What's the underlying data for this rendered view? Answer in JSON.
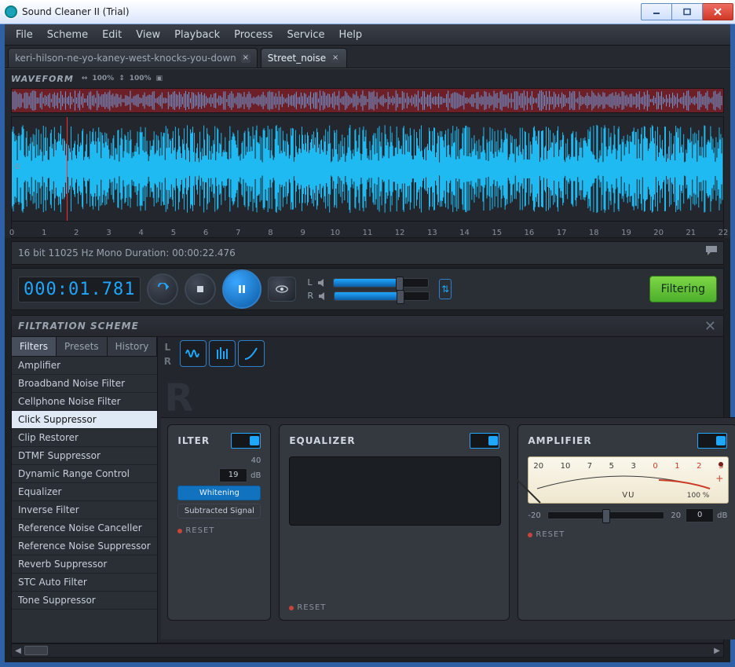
{
  "window": {
    "title": "Sound Cleaner II (Trial)"
  },
  "menu": {
    "items": [
      "File",
      "Scheme",
      "Edit",
      "View",
      "Playback",
      "Process",
      "Service",
      "Help"
    ]
  },
  "tabs": [
    {
      "label": "keri-hilson-ne-yo-kaney-west-knocks-you-down",
      "active": false
    },
    {
      "label": "Street_noise",
      "active": true
    }
  ],
  "waveform": {
    "header": "WAVEFORM",
    "zoom1": "100%",
    "zoom2": "100%",
    "ruler_ticks": [
      "0",
      "1",
      "2",
      "3",
      "4",
      "5",
      "6",
      "7",
      "8",
      "9",
      "10",
      "11",
      "12",
      "13",
      "14",
      "15",
      "16",
      "17",
      "18",
      "19",
      "20",
      "21",
      "22"
    ],
    "playhead_sec": 1.78
  },
  "status": {
    "text": "16 bit  11025 Hz  Mono  Duration:  00:00:22.476"
  },
  "transport": {
    "timecode": "000:01.781",
    "vol": {
      "L": "L",
      "R": "R",
      "l_pct": 70,
      "r_pct": 70
    },
    "filtering_label": "Filtering"
  },
  "filtration": {
    "title": "FILTRATION SCHEME",
    "left_tabs": [
      {
        "label": "Filters",
        "active": true
      },
      {
        "label": "Presets",
        "active": false
      },
      {
        "label": "History",
        "active": false
      }
    ],
    "filter_list": [
      "Amplifier",
      "Broadband Noise Filter",
      "Cellphone Noise Filter",
      "Click Suppressor",
      "Clip Restorer",
      "DTMF Suppressor",
      "Dynamic Range Control",
      "Equalizer",
      "Inverse Filter",
      "Reference Noise Canceller",
      "Reference Noise Suppressor",
      "Reverb Suppressor",
      "STC Auto Filter",
      "Tone Suppressor"
    ],
    "selected_filter": "Click Suppressor",
    "lr": {
      "L": "L",
      "R": "R"
    },
    "big_R": "R"
  },
  "modules": {
    "broadband": {
      "title": "ILTER",
      "tick_label": "40",
      "value": "19",
      "unit": "dB",
      "button_whitening": "Whitening",
      "button_subtracted": "Subtracted Signal",
      "reset": "RESET"
    },
    "equalizer": {
      "title": "EQUALIZER",
      "reset": "RESET"
    },
    "amplifier": {
      "title": "AMPLIFIER",
      "vu_scale": [
        "20",
        "10",
        "7",
        "5",
        "3",
        "0",
        "1",
        "2",
        "3"
      ],
      "vu_label": "VU",
      "vu_pct": "100 %",
      "gain_min": "-20",
      "gain_max": "20",
      "gain_value": "0",
      "gain_unit": "dB",
      "reset": "RESET"
    }
  }
}
